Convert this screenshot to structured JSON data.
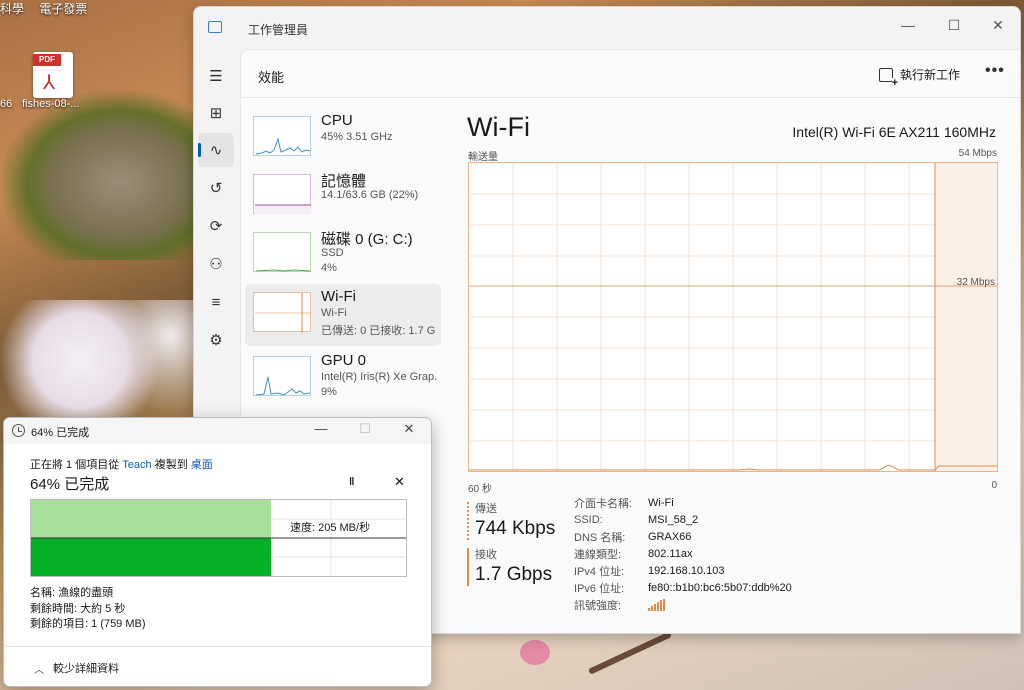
{
  "desktop": {
    "top_texts": [
      "科學",
      "電子發票"
    ],
    "icons": [
      {
        "label": "fishes-08-...",
        "type": "pdf",
        "badge": "PDF"
      },
      {
        "label": "66"
      }
    ]
  },
  "task_manager": {
    "title": "工作管理員",
    "page_title": "效能",
    "run_new_task": "執行新工作",
    "more": "•••",
    "nav_icons": [
      "hamburger-icon",
      "processes-icon",
      "performance-icon",
      "app-history-icon",
      "startup-icon",
      "users-icon",
      "details-icon",
      "services-icon"
    ],
    "devices": [
      {
        "name": "CPU",
        "sub1": "45%  3.51 GHz",
        "sub2": ""
      },
      {
        "name": "記憶體",
        "sub1": "14.1/63.6 GB (22%)",
        "sub2": ""
      },
      {
        "name": "磁碟 0 (G: C:)",
        "sub1": "SSD",
        "sub2": "4%"
      },
      {
        "name": "Wi-Fi",
        "sub1": "Wi-Fi",
        "sub2": "已傳送: 0  已接收: 1.7 G"
      },
      {
        "name": "GPU 0",
        "sub1": "Intel(R) Iris(R) Xe Grap.",
        "sub2": "9%"
      }
    ],
    "detail": {
      "title": "Wi-Fi",
      "model": "Intel(R) Wi-Fi 6E AX211 160MHz",
      "throughput_label": "輸送量",
      "max_label": "54 Mbps",
      "mid_label": "32 Mbps",
      "time_label": "60 秒",
      "zero_label": "0",
      "send_label": "傳送",
      "send_value": "744 Kbps",
      "recv_label": "接收",
      "recv_value": "1.7 Gbps",
      "properties": [
        {
          "key": "介面卡名稱:",
          "value": "Wi-Fi"
        },
        {
          "key": "SSID:",
          "value": "MSI_58_2"
        },
        {
          "key": "DNS 名稱:",
          "value": "GRAX66"
        },
        {
          "key": "連線類型:",
          "value": "802.11ax"
        },
        {
          "key": "IPv4 位址:",
          "value": "192.168.10.103"
        },
        {
          "key": "IPv6 位址:",
          "value": "fe80::b1b0:bc6:5b07:ddb%20"
        },
        {
          "key": "訊號強度:",
          "value": ""
        }
      ],
      "accent_color": "#e08b4c"
    }
  },
  "copy_dialog": {
    "title": "64% 已完成",
    "status_prefix": "正在將 1 個項目從 ",
    "source": "Teach",
    "status_mid": " 複製到 ",
    "destination": "桌面",
    "percent_text": "64% 已完成",
    "progress": 0.64,
    "speed": "速度: 205 MB/秒",
    "name_line": "名稱: 漁線的盡頭",
    "time_line": "剩餘時間: 大約 5 秒",
    "items_line": "剩餘的項目: 1 (759 MB)",
    "less_details": "較少詳細資料",
    "accent_color": "#06b025"
  }
}
